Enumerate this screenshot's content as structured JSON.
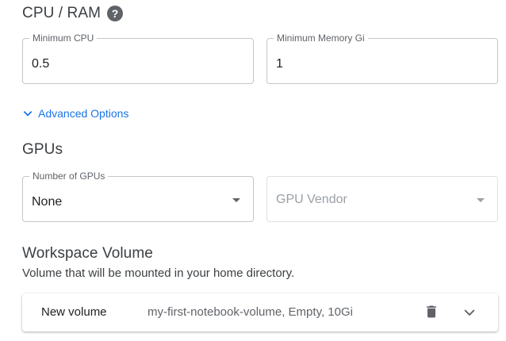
{
  "cpu_ram": {
    "title": "CPU / RAM",
    "help_icon": "help-icon",
    "min_cpu": {
      "label": "Minimum CPU",
      "value": "0.5"
    },
    "min_memory": {
      "label": "Minimum Memory Gi",
      "value": "1"
    }
  },
  "advanced_options": {
    "label": "Advanced Options",
    "icon": "chevron-down-icon"
  },
  "gpus": {
    "title": "GPUs",
    "number": {
      "label": "Number of GPUs",
      "value": "None"
    },
    "vendor": {
      "placeholder": "GPU Vendor",
      "disabled": true
    }
  },
  "workspace_volume": {
    "title": "Workspace Volume",
    "subtitle": "Volume that will be mounted in your home directory.",
    "volume": {
      "type": "New volume",
      "description": "my-first-notebook-volume, Empty, 10Gi",
      "delete_icon": "trash-icon",
      "expand_icon": "chevron-down-icon"
    }
  },
  "colors": {
    "accent": "#1a73e8",
    "text": "#202124",
    "muted": "#5f6368",
    "border": "#c4c7c5"
  }
}
